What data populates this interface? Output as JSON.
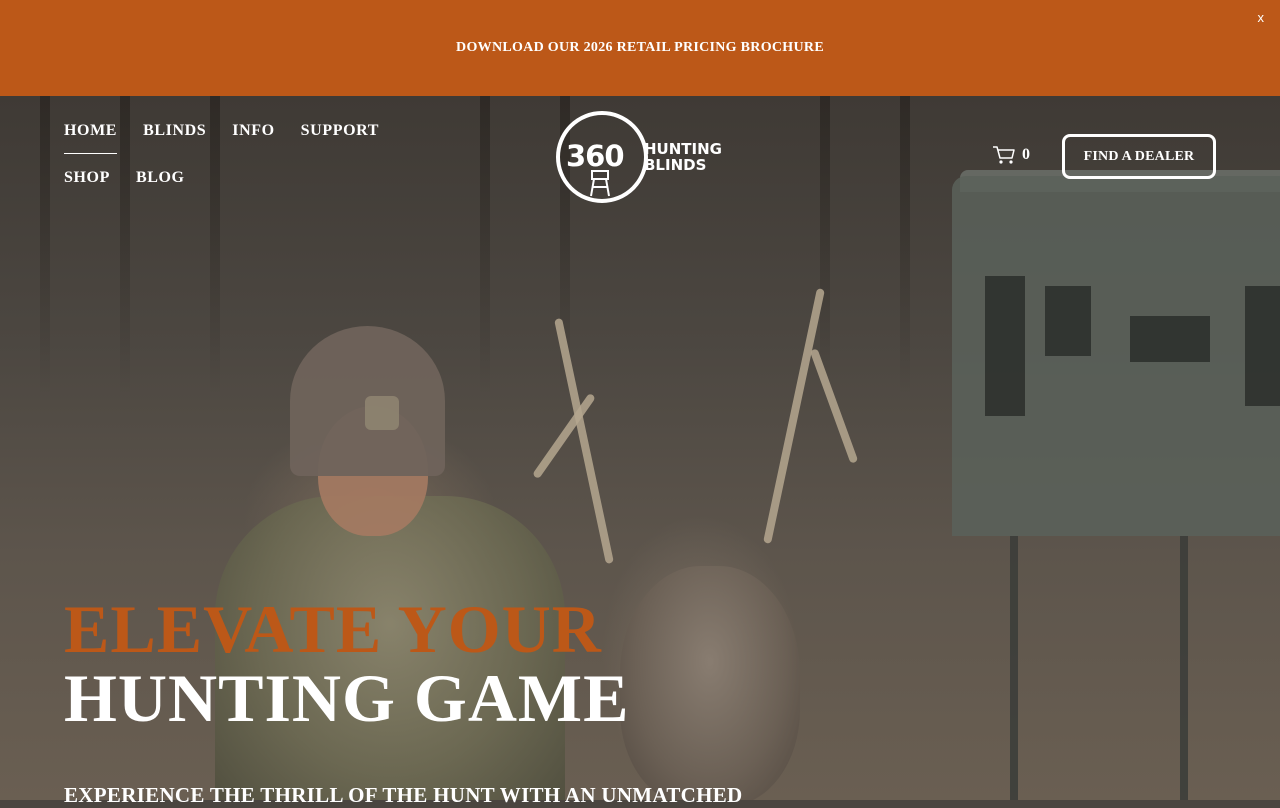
{
  "announcement": {
    "text": "DOWNLOAD OUR 2026 RETAIL PRICING BROCHURE",
    "close_label": "x"
  },
  "nav": {
    "items": [
      {
        "label": "HOME",
        "active": true
      },
      {
        "label": "BLINDS"
      },
      {
        "label": "INFO"
      },
      {
        "label": "SUPPORT"
      },
      {
        "label": "SHOP"
      },
      {
        "label": "BLOG"
      }
    ]
  },
  "logo": {
    "number": "360",
    "line1": "HUNTING",
    "line2": "BLINDS"
  },
  "cart": {
    "icon": "cart-icon",
    "count": "0"
  },
  "cta": {
    "find_dealer": "FIND A DEALER"
  },
  "hero": {
    "headline_accent": "ELEVATE YOUR",
    "headline_main": "HUNTING GAME",
    "subtext": "EXPERIENCE THE THRILL OF THE HUNT WITH AN UNMATCHED"
  },
  "colors": {
    "accent": "#bc5818",
    "text_light": "#ffffff"
  }
}
